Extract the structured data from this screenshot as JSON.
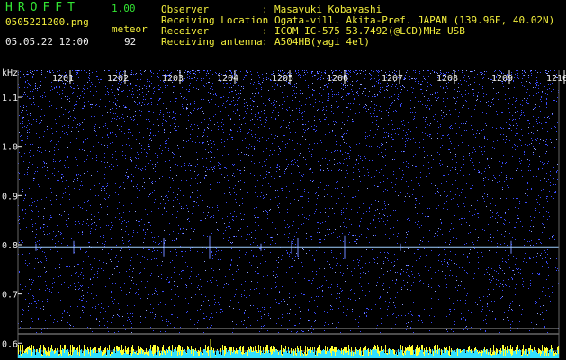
{
  "header": {
    "app_title": "HROFFT",
    "app_version": "1.00",
    "filename": "0505221200.png",
    "datetime": "05.05.22 12:00",
    "meteor_label": "meteor",
    "meteor_count": "92"
  },
  "info": [
    {
      "label": "Observer",
      "value": "Masayuki Kobayashi"
    },
    {
      "label": "Receiving Location",
      "value": "Ogata-vill. Akita-Pref. JAPAN (139.96E, 40.02N)"
    },
    {
      "label": "Receiver",
      "value": "ICOM IC-575 53.7492(@LCD)MHz USB"
    },
    {
      "label": "Receiving antenna",
      "value": "A504HB(yagi 4el)"
    }
  ],
  "colors": {
    "header_green": "#33e633",
    "header_yellow": "#f2ee3c",
    "noise_blue": "#3a4cff",
    "carrier_line": "#9fd0ff",
    "bars_yellow": "#ffff33",
    "bars_cyan": "#33e0ff"
  },
  "chart_data": {
    "type": "heatmap",
    "ylabel": "kHz",
    "x_tick_labels": [
      "1201",
      "1202",
      "1203",
      "1204",
      "1205",
      "1206",
      "1207",
      "1208",
      "1209",
      "1210"
    ],
    "y_tick_labels": [
      "1.1",
      "1.0",
      "0.9",
      "0.8",
      "0.7",
      "0.6"
    ],
    "y_ticks": [
      1.1,
      1.0,
      0.9,
      0.8,
      0.7,
      0.6
    ],
    "xlim_minutes": [
      0,
      10
    ],
    "ylim_khz": [
      0.58,
      1.16
    ],
    "carrier_khz": 0.795
  }
}
